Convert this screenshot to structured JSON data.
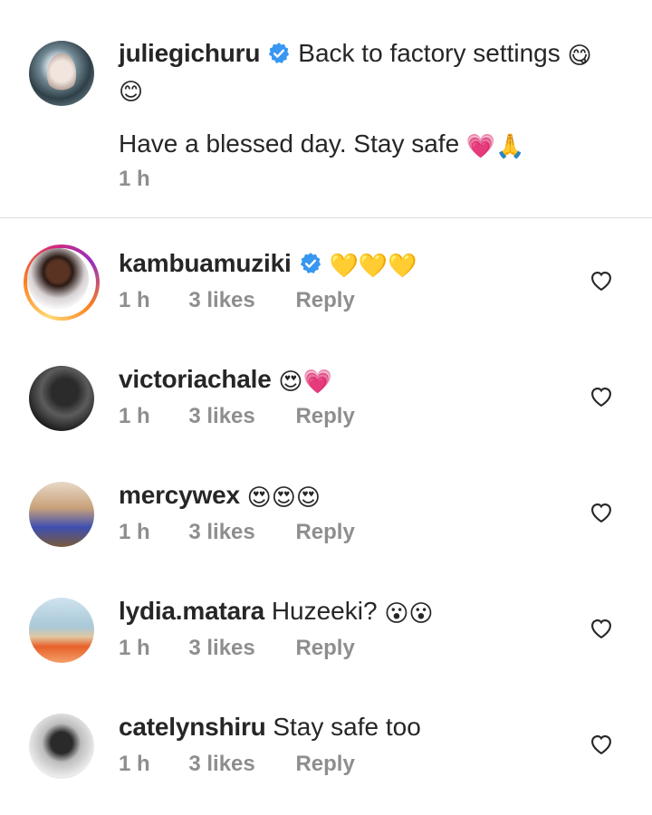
{
  "post": {
    "username": "juliegichuru",
    "verified": true,
    "caption_line1": "Back to factory settings",
    "caption_line1_emojis": "😋",
    "caption_line1b_emojis": "😊",
    "caption_line2": "Have a blessed day. Stay safe",
    "caption_line2_emojis": "💗🙏",
    "time": "1 h"
  },
  "comments": [
    {
      "username": "kambuamuziki",
      "verified": true,
      "text": "",
      "emojis": "💛💛💛",
      "time": "1 h",
      "likes": "3 likes",
      "reply": "Reply",
      "story_ring": true
    },
    {
      "username": "victoriachale",
      "verified": false,
      "text": "",
      "emojis": "😍💗",
      "time": "1 h",
      "likes": "3 likes",
      "reply": "Reply",
      "story_ring": false
    },
    {
      "username": "mercywex",
      "verified": false,
      "text": "",
      "emojis": "😍😍😍",
      "time": "1 h",
      "likes": "3 likes",
      "reply": "Reply",
      "story_ring": false
    },
    {
      "username": "lydia.matara",
      "verified": false,
      "text": "Huzeeki?",
      "emojis": "😮😮",
      "time": "1 h",
      "likes": "3 likes",
      "reply": "Reply",
      "story_ring": false
    },
    {
      "username": "catelynshiru",
      "verified": false,
      "text": "Stay safe too",
      "emojis": "",
      "time": "1 h",
      "likes": "3 likes",
      "reply": "Reply",
      "story_ring": false
    }
  ],
  "icons": {
    "verified_badge": "verified-badge-icon",
    "like": "heart-outline-icon"
  },
  "colors": {
    "verified_blue": "#3897f0",
    "meta_gray": "#8e8e8e",
    "divider": "#dbdbdb"
  }
}
